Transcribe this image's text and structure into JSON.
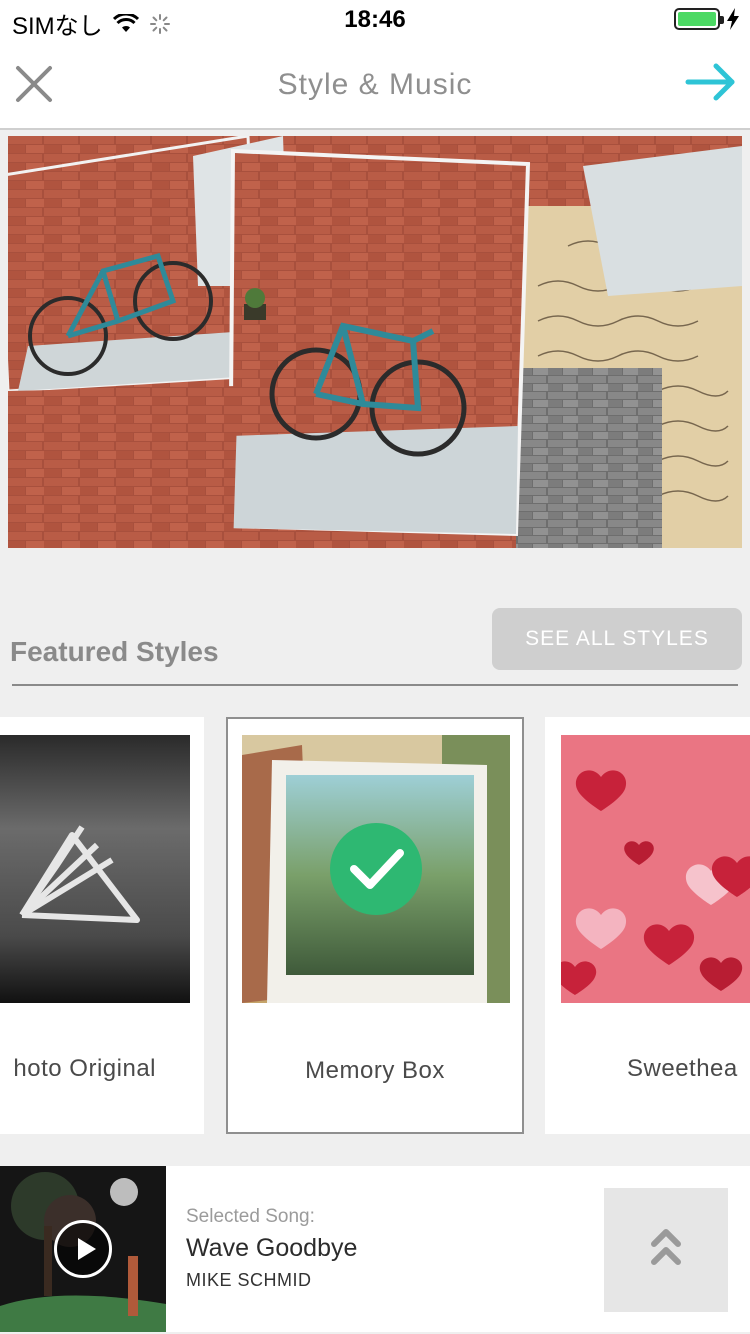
{
  "status_bar": {
    "carrier": "SIMなし",
    "time": "18:46",
    "icons": [
      "wifi-icon",
      "activity-spinner-icon",
      "battery-icon",
      "charging-bolt-icon"
    ]
  },
  "nav": {
    "title": "Style & Music",
    "close_icon": "close-icon",
    "next_icon": "arrow-right-icon",
    "accent_color": "#2ec4d6"
  },
  "featured": {
    "title": "Featured Styles",
    "see_all_label": "SEE ALL STYLES",
    "styles": [
      {
        "label": "hoto Original",
        "selected": false
      },
      {
        "label": "Memory Box",
        "selected": true
      },
      {
        "label": "Sweethea",
        "selected": false
      }
    ],
    "selected_color": "#2eb872"
  },
  "song": {
    "caption": "Selected Song:",
    "title": "Wave Goodbye",
    "artist": "MIKE SCHMID",
    "play_icon": "play-icon",
    "expand_icon": "chevron-double-up-icon"
  }
}
